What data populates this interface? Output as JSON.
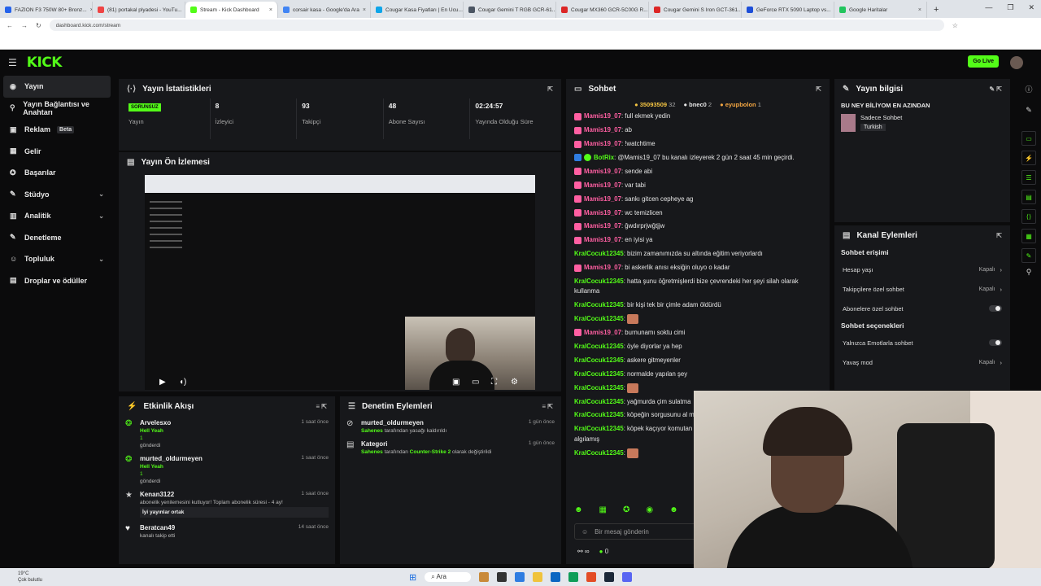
{
  "browser": {
    "tabs": [
      {
        "label": "FAZION F3 750W 80+ Bronz...",
        "color": "#2563eb"
      },
      {
        "label": "(81) portakal plyadesi - YouTu...",
        "color": "#ef4444"
      },
      {
        "label": "Stream - Kick Dashboard",
        "color": "#53fc18"
      },
      {
        "label": "corsair kasa - Google'da Ara",
        "color": "#4285f4"
      },
      {
        "label": "Cougar Kasa Fiyatları | En Ucu...",
        "color": "#0ea5e9"
      },
      {
        "label": "Cougar Gemini T RGB GCR-61...",
        "color": "#4b5563"
      },
      {
        "label": "Cougar MX360 GCR-5C00G R...",
        "color": "#dc2626"
      },
      {
        "label": "Cougar Gemini S Iron GCT-361...",
        "color": "#dc2626"
      },
      {
        "label": "GeForce RTX 5090 Laptop vs...",
        "color": "#1d4ed8"
      },
      {
        "label": "Google Haritalar",
        "color": "#22c55e"
      }
    ],
    "url": "dashboard.kick.com/stream"
  },
  "header": {
    "logo": "KICK",
    "go_live": "Go Live"
  },
  "sidebar": {
    "items": [
      {
        "label": "Yayın",
        "icon": "radio-icon",
        "active": true
      },
      {
        "label": "Yayın Bağlantısı ve Anahtarı",
        "icon": "key-icon"
      },
      {
        "label": "Reklam",
        "icon": "ad-icon",
        "badge": "Beta"
      },
      {
        "label": "Gelir",
        "icon": "money-icon"
      },
      {
        "label": "Başarılar",
        "icon": "trophy-icon"
      },
      {
        "label": "Stüdyo",
        "icon": "studio-icon",
        "chevron": true
      },
      {
        "label": "Analitik",
        "icon": "chart-icon",
        "chevron": true
      },
      {
        "label": "Denetleme",
        "icon": "wrench-icon"
      },
      {
        "label": "Topluluk",
        "icon": "users-icon",
        "chevron": true
      },
      {
        "label": "Droplar ve ödüller",
        "icon": "gift-icon"
      }
    ]
  },
  "stats": {
    "title": "Yayın İstatistikleri",
    "status_badge": "SORUNSUZ",
    "items": [
      {
        "value": "",
        "label": "Yayın"
      },
      {
        "value": "8",
        "label": "İzleyici"
      },
      {
        "value": "93",
        "label": "Takipçi"
      },
      {
        "value": "48",
        "label": "Abone Sayısı"
      },
      {
        "value": "02:24:57",
        "label": "Yayında Olduğu Süre"
      }
    ]
  },
  "preview": {
    "title": "Yayın Ön İzlemesi"
  },
  "activity": {
    "title": "Etkinlik Akışı",
    "items": [
      {
        "name": "Arvelesxo",
        "time": "1 saat önce",
        "line1": "Hell Yeah",
        "line2": "1",
        "line3": "gönderdi"
      },
      {
        "name": "murted_oldurmeyen",
        "time": "1 saat önce",
        "line1": "Hell Yeah",
        "line2": "1",
        "line3": "gönderdi"
      },
      {
        "name": "Kenan3122",
        "time": "1 saat önce",
        "line1": "abonelik yenilemesini kutluyor! Toplam abonelik süresi - 4 ay!",
        "line2": "İyi yayınlar ortak",
        "line3": ""
      },
      {
        "name": "Beratcan49",
        "time": "14 saat önce",
        "line1": "kanalı takip etti",
        "line2": "",
        "line3": ""
      }
    ]
  },
  "moderation": {
    "title": "Denetim Eylemleri",
    "items": [
      {
        "name": "murted_oldurmeyen",
        "time": "1 gün önce",
        "actor": "Sahenes",
        "text": "tarafından yasağı kaldırıldı"
      },
      {
        "name": "Kategori",
        "time": "1 gün önce",
        "actor": "Sahenes",
        "text": "tarafından",
        "target": "Counter-Strike 2",
        "suffix": "olarak değiştirildi"
      }
    ]
  },
  "chat": {
    "title": "Sohbet",
    "top_bar": {
      "points": "35093509",
      "count": "32",
      "user1": "bnec0",
      "user1_count": "2",
      "user2": "eyupbolon",
      "user2_count": "1"
    },
    "messages": [
      {
        "user": "Mamis19_07",
        "text": ": full ekmek yedin",
        "color": "pink"
      },
      {
        "user": "Mamis19_07",
        "text": ": ab",
        "color": "pink"
      },
      {
        "user": "Mamis19_07",
        "text": ": !watchtime",
        "color": "pink"
      },
      {
        "user": "BotRix",
        "text": ": @Mamis19_07 bu kanalı izleyerek 2 gün 2 saat 45 min geçirdi.",
        "color": "bot"
      },
      {
        "user": "Mamis19_07",
        "text": ": sende abi",
        "color": "pink"
      },
      {
        "user": "Mamis19_07",
        "text": ": var tabi",
        "color": "pink"
      },
      {
        "user": "Mamis19_07",
        "text": ": sankı gitcen cepheye ag",
        "color": "pink"
      },
      {
        "user": "Mamis19_07",
        "text": ": wc temizlicen",
        "color": "pink"
      },
      {
        "user": "Mamis19_07",
        "text": ": ğwdırprjwğtjjw",
        "color": "pink"
      },
      {
        "user": "Mamis19_07",
        "text": ": en iyisi ya",
        "color": "pink"
      },
      {
        "user": "KralCocuk12345",
        "text": ": bizim zamanımızda su altında eğitim veriyorlardı",
        "color": "green"
      },
      {
        "user": "Mamis19_07",
        "text": ": bi askerlik anısı eksiğin oluyo o kadar",
        "color": "pink"
      },
      {
        "user": "KralCocuk12345",
        "text": ": hatta şunu öğretmişlerdi bize çevrendeki her şeyi silah olarak kullanma",
        "color": "green"
      },
      {
        "user": "KralCocuk12345",
        "text": ": bir kişi tek bir çimle adam öldürdü",
        "color": "green"
      },
      {
        "user": "KralCocuk12345",
        "text": ":",
        "color": "green",
        "emote": true
      },
      {
        "user": "Mamis19_07",
        "text": ": burnunamı soktu cimi",
        "color": "pink"
      },
      {
        "user": "KralCocuk12345",
        "text": ": öyle diyorlar ya hep",
        "color": "green"
      },
      {
        "user": "KralCocuk12345",
        "text": ": askere gitmeyenler",
        "color": "green"
      },
      {
        "user": "KralCocuk12345",
        "text": ": normalde yapılan şey",
        "color": "green"
      },
      {
        "user": "KralCocuk12345",
        "text": ":",
        "color": "green",
        "emote": true
      },
      {
        "user": "KralCocuk12345",
        "text": ": yağmurda çim sulatma",
        "color": "green"
      },
      {
        "user": "KralCocuk12345",
        "text": ": köpeğin sorgusunu al mürekkep bastırmışlar köpeğe",
        "color": "green"
      },
      {
        "user": "KralCocuk12345",
        "text": ": köpek kaçıyor komutan komutan it olarak köpekten sorumlu asker algılamış",
        "color": "green"
      },
      {
        "user": "KralCocuk12345",
        "text": ":",
        "color": "green",
        "emote": true
      }
    ],
    "input_placeholder": "Bir mesaj gönderin",
    "footer_count": "0"
  },
  "stream_info": {
    "title": "Yayın bilgisi",
    "stream_title": "BU NEY BİLİYOM EN AZINDAN",
    "category": "Sadece Sohbet",
    "language": "Turkish"
  },
  "channel_actions": {
    "title": "Kanal Eylemleri",
    "section1": "Sohbet erişimi",
    "rows1": [
      {
        "label": "Hesap yaşı",
        "value": "Kapalı"
      },
      {
        "label": "Takipçilere özel sohbet",
        "value": "Kapalı"
      },
      {
        "label": "Abonelere özel sohbet",
        "value": ""
      }
    ],
    "section2": "Sohbet seçenekleri",
    "rows2": [
      {
        "label": "Yalnızca Emotlarla sohbet",
        "value": ""
      },
      {
        "label": "Yavaş mod",
        "value": "Kapalı"
      }
    ]
  },
  "taskbar": {
    "weather_temp": "19°C",
    "weather_desc": "Çok bulutlu",
    "search": "Ara"
  }
}
